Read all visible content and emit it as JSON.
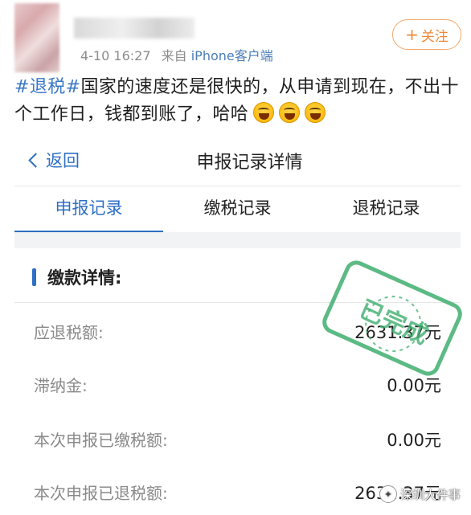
{
  "post": {
    "meta_time": "4-10 16:27",
    "meta_from": "来自",
    "meta_source": "iPhone客户端",
    "follow_label": "关注",
    "text_tag": "#退税#",
    "text_body": "国家的速度还是很快的，从申请到现在，不出十个工作日，钱都到账了，哈哈",
    "emojis": [
      "laughing-emoji",
      "laughing-emoji",
      "laughing-emoji"
    ]
  },
  "app": {
    "back_label": "返回",
    "nav_title": "申报记录详情",
    "tabs": [
      {
        "label": "申报记录",
        "active": true
      },
      {
        "label": "缴税记录",
        "active": false
      },
      {
        "label": "退税记录",
        "active": false
      }
    ],
    "section_title": "缴款详情:",
    "rows": [
      {
        "label": "应退税额:",
        "value": "2631.37元"
      },
      {
        "label": "滞纳金:",
        "value": "0.00元"
      },
      {
        "label": "本次申报已缴税额:",
        "value": "0.00元"
      },
      {
        "label": "本次申报已退税额:",
        "value": "2631.37元"
      }
    ],
    "stamp_text": "已完成"
  },
  "watermark": {
    "text": "深圳大件事"
  },
  "colors": {
    "accent_blue": "#2f6fc4",
    "tag_blue": "#3b78c6",
    "follow_orange": "#f08a3a",
    "stamp_green": "#3fae6f"
  }
}
